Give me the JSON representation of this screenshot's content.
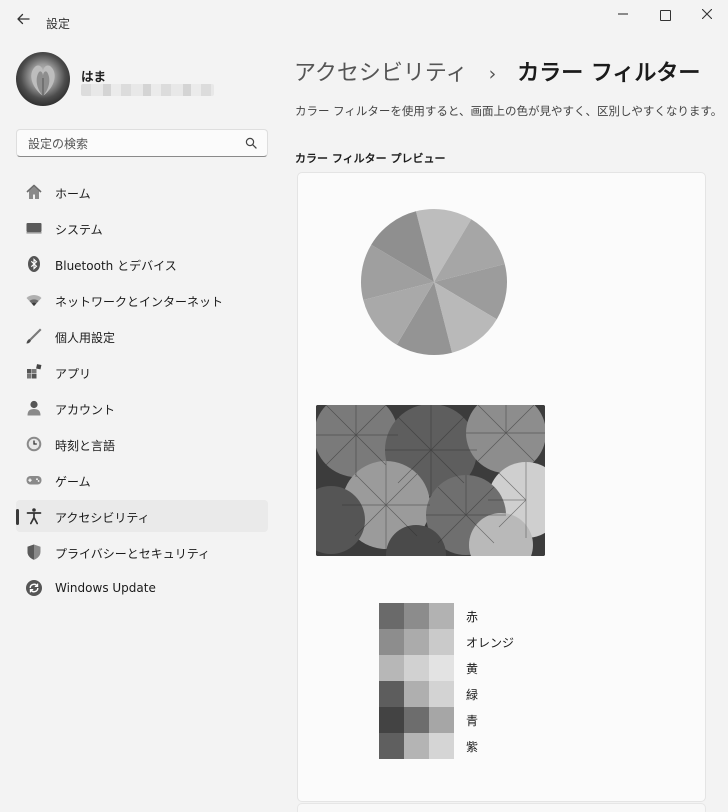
{
  "window": {
    "title": "設定"
  },
  "user": {
    "name": "はま"
  },
  "search": {
    "placeholder": "設定の検索"
  },
  "nav": {
    "items": [
      {
        "label": "ホーム",
        "icon": "home-icon"
      },
      {
        "label": "システム",
        "icon": "system-icon"
      },
      {
        "label": "Bluetooth とデバイス",
        "icon": "bluetooth-icon"
      },
      {
        "label": "ネットワークとインターネット",
        "icon": "wifi-icon"
      },
      {
        "label": "個人用設定",
        "icon": "brush-icon"
      },
      {
        "label": "アプリ",
        "icon": "apps-icon"
      },
      {
        "label": "アカウント",
        "icon": "person-icon"
      },
      {
        "label": "時刻と言語",
        "icon": "time-language-icon"
      },
      {
        "label": "ゲーム",
        "icon": "gamepad-icon"
      },
      {
        "label": "アクセシビリティ",
        "icon": "accessibility-icon",
        "active": true
      },
      {
        "label": "プライバシーとセキュリティ",
        "icon": "shield-icon"
      },
      {
        "label": "Windows Update",
        "icon": "update-icon"
      }
    ]
  },
  "page": {
    "breadcrumb_parent": "アクセシビリティ",
    "breadcrumb_separator": "›",
    "title": "カラー フィルター",
    "description": "カラー フィルターを使用すると、画面上の色が見やすく、区別しやすくなります。",
    "preview_heading": "カラー フィルター プレビュー"
  },
  "preview": {
    "pie_colors": [
      "#bdbdbd",
      "#a6a6a6",
      "#9c9c9c",
      "#b9b9b9",
      "#949494",
      "#a9a9a9",
      "#9f9f9f",
      "#8f8f8f"
    ],
    "swatches": [
      {
        "label": "赤",
        "colors": [
          "#6a6a6a",
          "#8c8c8c",
          "#b2b2b2"
        ]
      },
      {
        "label": "オレンジ",
        "colors": [
          "#8d8d8d",
          "#ababab",
          "#cacaca"
        ]
      },
      {
        "label": "黄",
        "colors": [
          "#b7b7b7",
          "#d1d1d1",
          "#e3e3e3"
        ]
      },
      {
        "label": "緑",
        "colors": [
          "#5d5d5d",
          "#afafaf",
          "#d3d3d3"
        ]
      },
      {
        "label": "青",
        "colors": [
          "#434343",
          "#6d6d6d",
          "#a6a6a6"
        ]
      },
      {
        "label": "紫",
        "colors": [
          "#5f5f5f",
          "#b4b4b4",
          "#d5d5d5"
        ]
      }
    ]
  }
}
